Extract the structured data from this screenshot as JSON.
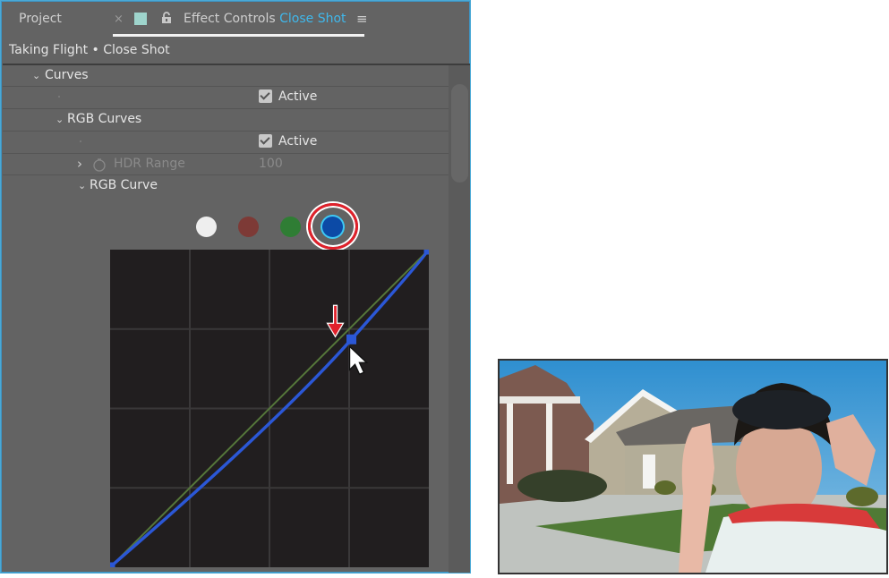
{
  "panel": {
    "tabs": {
      "project_label": "Project",
      "close_glyph": "×",
      "effect_controls_label": "Effect Controls",
      "clip_name": "Close Shot",
      "menu_glyph": "≡"
    },
    "subtitle": "Taking Flight • Close Shot",
    "rows": {
      "curves": {
        "label": "Curves",
        "chevron": "⌄"
      },
      "curves_active": {
        "label": "Active",
        "checked": true
      },
      "rgb_curves": {
        "label": "RGB Curves",
        "chevron": "⌄"
      },
      "rgb_curves_active": {
        "label": "Active",
        "checked": true
      },
      "hdr_range": {
        "label": "HDR Range",
        "value": "100",
        "chevron": "›"
      },
      "rgb_curve": {
        "label": "RGB Curve",
        "chevron": "⌄"
      }
    },
    "channels": [
      {
        "name": "master",
        "color": "#eeeeee"
      },
      {
        "name": "red",
        "color": "#7d3a36"
      },
      {
        "name": "green",
        "color": "#2f7d34"
      },
      {
        "name": "blue",
        "color": "#0c4aa6",
        "selected": true,
        "outline": "#3ec8f3"
      }
    ],
    "annotation_color": "#e0212b"
  },
  "curve": {
    "active_channel": "blue",
    "line_color": "#2b57d6",
    "reference_line_color": "#55773a",
    "grid_divisions": 4,
    "points": [
      [
        0,
        0
      ],
      [
        0.76,
        0.72
      ],
      [
        1,
        1
      ]
    ]
  },
  "viewer": {
    "description": "Boy with goggles and red cape in front of suburban houses"
  }
}
